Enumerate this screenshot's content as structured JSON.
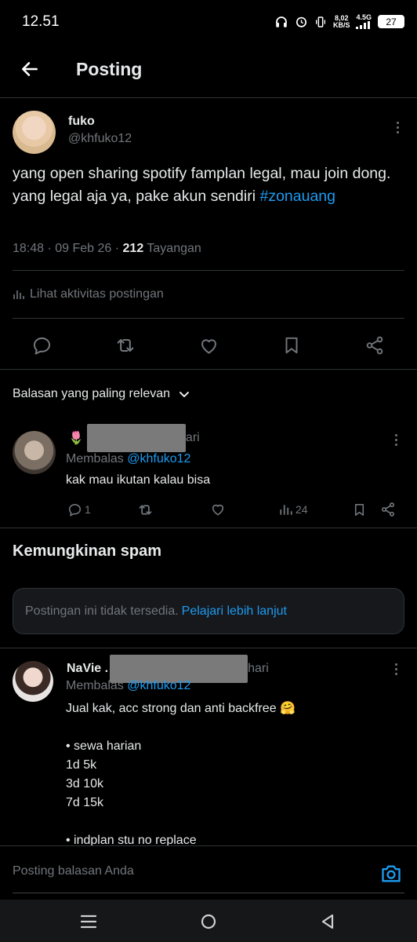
{
  "status_bar": {
    "time": "12.51",
    "net_speed_value": "8,02",
    "net_speed_unit": "KB/S",
    "network": "4.5G",
    "battery": "27"
  },
  "header": {
    "title": "Posting"
  },
  "post": {
    "author_name": "fuko",
    "author_handle": "@khfuko12",
    "text": "yang open sharing spotify famplan legal, mau join dong. yang legal aja ya, pake akun sendiri ",
    "hashtag": "#zonauang",
    "timestamp": "18:48 · 09 Feb 26 · ",
    "views_count": "212",
    "views_label": " Tayangan",
    "activity_label": "Lihat aktivitas postingan"
  },
  "replies_sort": {
    "label": "Balasan yang paling relevan"
  },
  "reply1": {
    "name_prefix": "🌷",
    "name_suffix": "ari",
    "replying_label": "Membalas ",
    "replying_handle": "@khfuko12",
    "text": "kak mau ikutan kalau bisa",
    "reply_count": "1",
    "views": "24"
  },
  "spam_section": {
    "title": "Kemungkinan spam",
    "notice_text": "Postingan ini tidak tersedia. ",
    "notice_link": "Pelajari lebih lanjut"
  },
  "reply2": {
    "name_prefix": "NaVie .",
    "name_suffix": "hari",
    "replying_label": "Membalas ",
    "replying_handle": "@khfuko12",
    "lines": [
      "Jual kak, acc strong dan anti backfree 🤗",
      "",
      "• sewa harian",
      "1d 5k",
      "3d 10k",
      "7d 15k",
      "",
      "• indplan stu no replace"
    ]
  },
  "compose": {
    "placeholder": "Posting balasan Anda"
  },
  "colors": {
    "accent": "#1d9bf0",
    "background": "#000000",
    "muted": "#71767b",
    "border": "#2f3336"
  },
  "icons": [
    "back-arrow-icon",
    "more-icon",
    "reply-icon",
    "repost-icon",
    "like-icon",
    "bookmark-icon",
    "share-icon",
    "analytics-icon",
    "chevron-down-icon",
    "camera-icon",
    "menu-icon",
    "home-icon",
    "back-nav-icon"
  ]
}
